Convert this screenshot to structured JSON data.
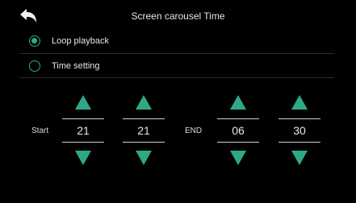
{
  "header": {
    "title": "Screen carousel Time",
    "back_icon": "back-arrow-icon"
  },
  "options": [
    {
      "label": "Loop playback",
      "checked": true
    },
    {
      "label": "Time setting",
      "checked": false
    }
  ],
  "time_settings": {
    "start_label": "Start",
    "end_label": "END",
    "start_hour": "21",
    "start_minute": "21",
    "end_hour": "06",
    "end_minute": "30"
  },
  "colors": {
    "accent": "#2ea987",
    "background": "#000000",
    "text": "#e6e6e6"
  }
}
